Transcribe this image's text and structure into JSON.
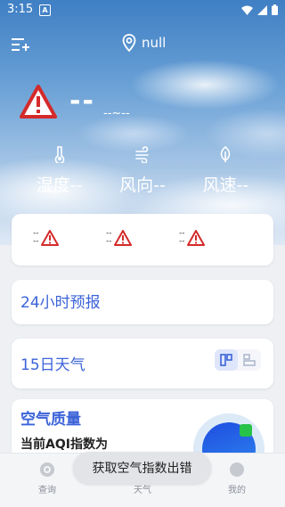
{
  "status_bar": {
    "time": "3:15",
    "notif_letter": "A"
  },
  "header": {
    "location": "null"
  },
  "current": {
    "temperature": "--",
    "range": "--~--",
    "metrics": [
      {
        "icon": "thermometer-icon",
        "label": "湿度--"
      },
      {
        "icon": "wind-icon",
        "label": "风向--"
      },
      {
        "icon": "leaf-icon",
        "label": "风速--"
      }
    ]
  },
  "forecast_strip": [
    {
      "top": "--",
      "bottom": "--"
    },
    {
      "top": "--",
      "bottom": "--"
    },
    {
      "top": "--",
      "bottom": "--"
    }
  ],
  "hourly": {
    "title": "24小时预报"
  },
  "daily": {
    "title": "15日天气"
  },
  "air_quality": {
    "title": "空气质量",
    "subtitle": "当前AQI指数为"
  },
  "nav": {
    "items": [
      {
        "label": "查询"
      },
      {
        "label": "天气"
      },
      {
        "label": "我的"
      }
    ]
  },
  "toast": {
    "message": "获取空气指数出错"
  },
  "colors": {
    "accent": "#3b63d8",
    "warning": "#d42a2a"
  }
}
